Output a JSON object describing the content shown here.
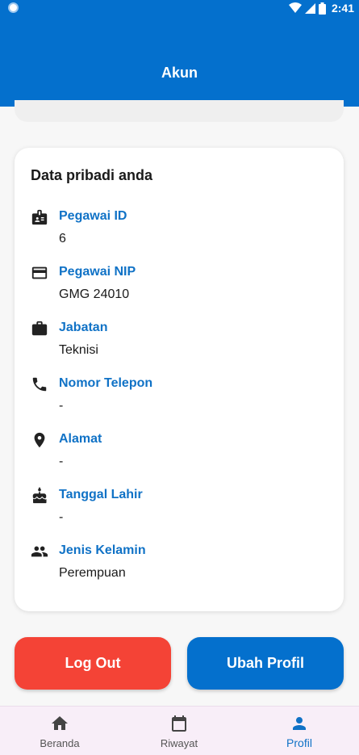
{
  "status_bar": {
    "time": "2:41"
  },
  "app_bar": {
    "title": "Akun"
  },
  "personal_card": {
    "title": "Data pribadi anda",
    "fields": [
      {
        "icon": "badge-icon",
        "label": "Pegawai ID",
        "value": "6"
      },
      {
        "icon": "credit-card-icon",
        "label": "Pegawai NIP",
        "value": "GMG 24010"
      },
      {
        "icon": "briefcase-icon",
        "label": "Jabatan",
        "value": "Teknisi"
      },
      {
        "icon": "phone-icon",
        "label": "Nomor Telepon",
        "value": "-"
      },
      {
        "icon": "location-pin-icon",
        "label": "Alamat",
        "value": "-"
      },
      {
        "icon": "cake-icon",
        "label": "Tanggal Lahir",
        "value": "-"
      },
      {
        "icon": "people-icon",
        "label": "Jenis Kelamin",
        "value": "Perempuan"
      }
    ]
  },
  "actions": {
    "logout_label": "Log Out",
    "edit_profile_label": "Ubah Profil"
  },
  "bottom_nav": {
    "items": [
      {
        "icon": "home-icon",
        "label": "Beranda",
        "active": false
      },
      {
        "icon": "calendar-icon",
        "label": "Riwayat",
        "active": false
      },
      {
        "icon": "person-icon",
        "label": "Profil",
        "active": true
      }
    ]
  },
  "colors": {
    "primary": "#0470cd",
    "label_blue": "#1072c6",
    "logout_red": "#f44336",
    "nav_background": "#f8eef8"
  }
}
